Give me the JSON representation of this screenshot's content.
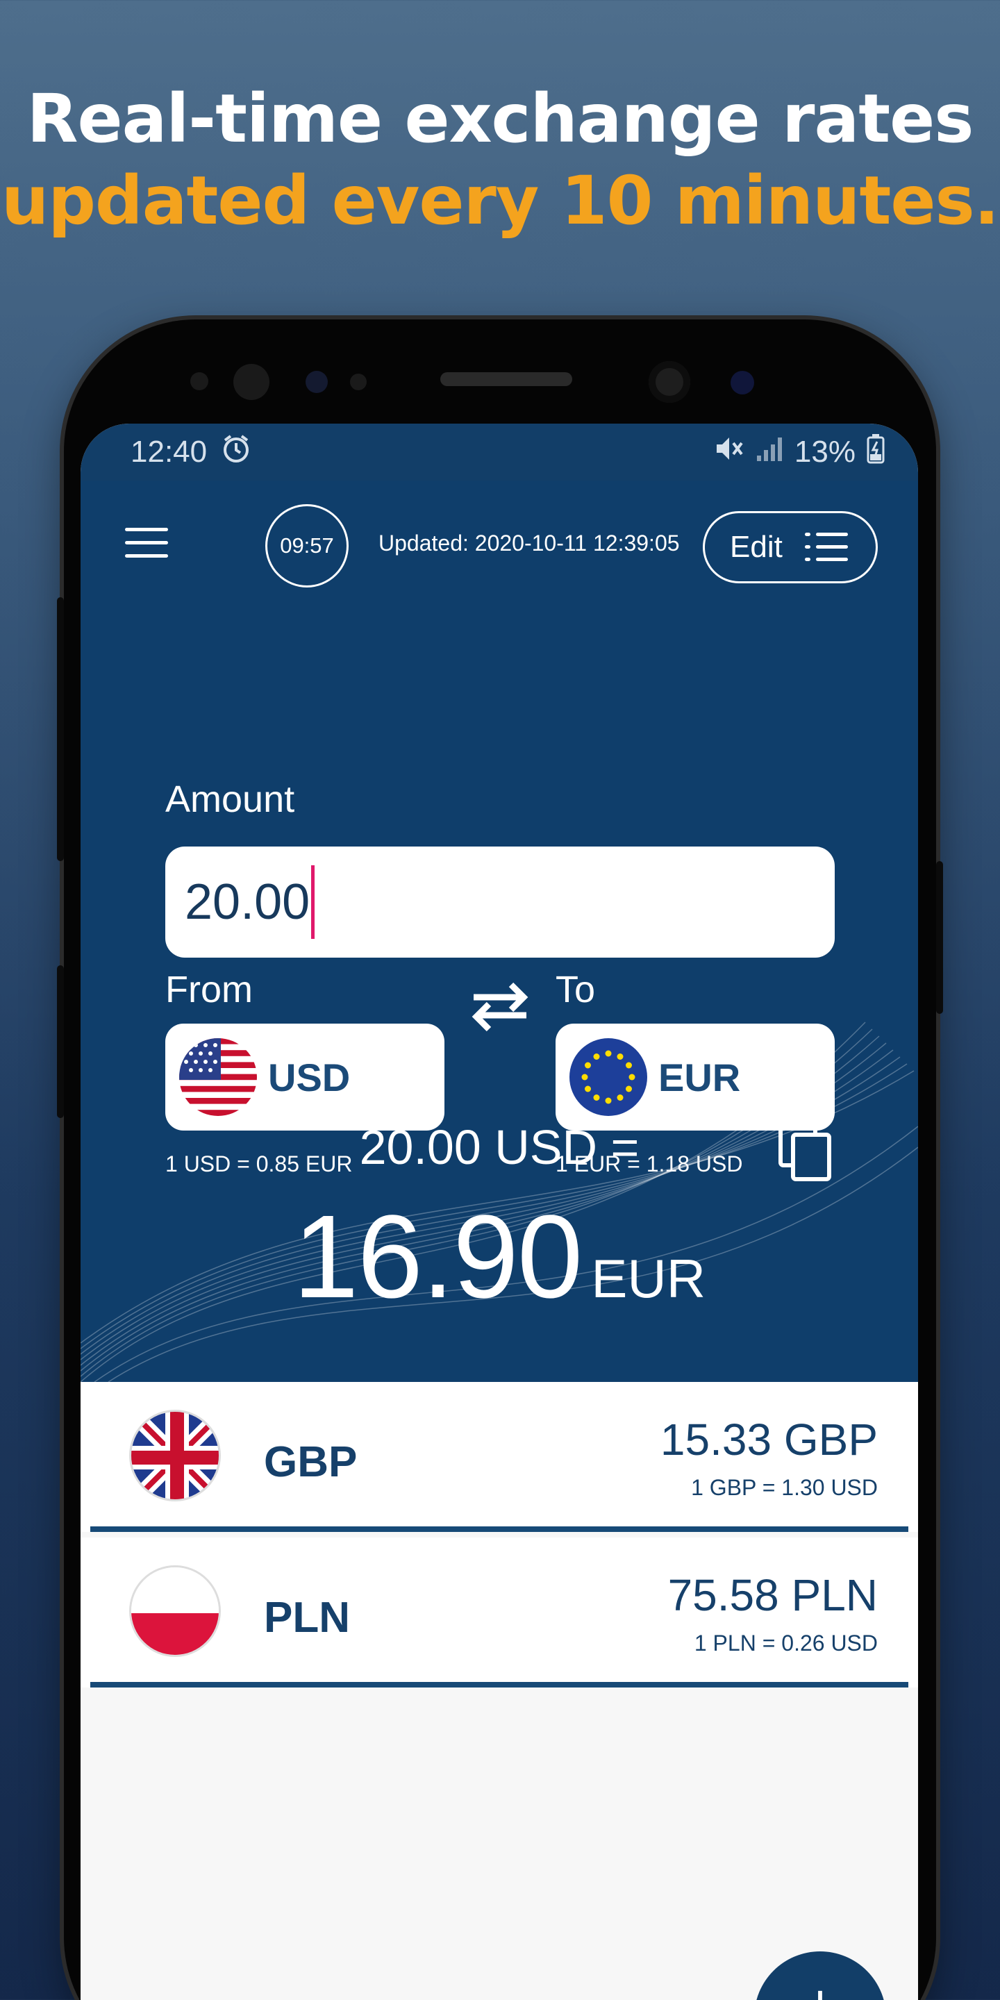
{
  "headline": {
    "line1": "Real-time exchange rates",
    "line2": "updated every 10 minutes."
  },
  "status_bar": {
    "time": "12:40",
    "battery": "13%"
  },
  "toolbar": {
    "timer": "09:57",
    "updated": "Updated: 2020-10-11 12:39:05",
    "edit_label": "Edit"
  },
  "converter": {
    "amount_label": "Amount",
    "amount_value": "20.00",
    "from_label": "From",
    "to_label": "To",
    "from_code": "USD",
    "to_code": "EUR",
    "from_rate": "1 USD = 0.85 EUR",
    "to_rate": "1 EUR = 1.18 USD",
    "source_line": "20.00 USD =",
    "result_value": "16.90",
    "result_currency": "EUR"
  },
  "currency_list": [
    {
      "code": "GBP",
      "value": "15.33 GBP",
      "rate": "1 GBP = 1.30 USD",
      "flag": "uk-flag"
    },
    {
      "code": "PLN",
      "value": "75.58 PLN",
      "rate": "1 PLN = 0.26 USD",
      "flag": "poland-flag"
    }
  ],
  "fab": {
    "label": "+"
  },
  "colors": {
    "accent": "#f4a31e",
    "primary": "#0f3e6b",
    "caret": "#e0196b"
  }
}
